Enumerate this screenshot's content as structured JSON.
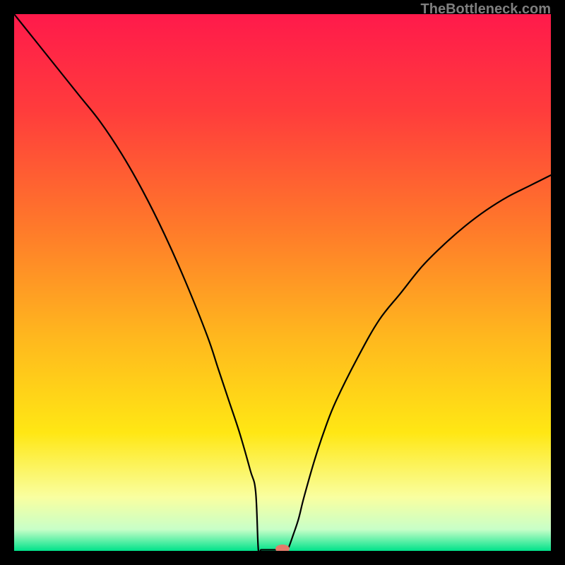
{
  "watermark": "TheBottleneck.com",
  "gradient": {
    "stops": [
      {
        "id": "g0",
        "offset": "0%",
        "color": "#ff1a4b"
      },
      {
        "id": "g1",
        "offset": "18%",
        "color": "#ff3c3c"
      },
      {
        "id": "g2",
        "offset": "40%",
        "color": "#ff7a2a"
      },
      {
        "id": "g3",
        "offset": "60%",
        "color": "#ffb71e"
      },
      {
        "id": "g4",
        "offset": "78%",
        "color": "#ffe714"
      },
      {
        "id": "g5",
        "offset": "90%",
        "color": "#f9ffa0"
      },
      {
        "id": "g6",
        "offset": "96%",
        "color": "#c8ffc8"
      },
      {
        "id": "g7",
        "offset": "100%",
        "color": "#00e28a"
      }
    ]
  },
  "chart_data": {
    "type": "line",
    "title": "",
    "xlabel": "",
    "ylabel": "",
    "xlim": [
      0,
      100
    ],
    "ylim": [
      0,
      100
    ],
    "marker": {
      "x": 50,
      "y": 0
    },
    "x": [
      0,
      4,
      8,
      12,
      16,
      20,
      24,
      28,
      32,
      36,
      38,
      40,
      42,
      44,
      45,
      46,
      47,
      48,
      50,
      51,
      52,
      53,
      54,
      56,
      58,
      60,
      64,
      68,
      72,
      76,
      80,
      84,
      88,
      92,
      96,
      100
    ],
    "values": [
      100,
      95,
      90,
      85,
      80,
      74,
      67,
      59,
      50,
      40,
      34,
      28,
      22,
      15,
      11,
      7,
      3,
      0.3,
      0,
      0.3,
      3,
      6,
      10,
      17,
      23,
      28,
      36,
      43,
      48,
      53,
      57,
      60.5,
      63.5,
      66,
      68,
      70
    ],
    "flat_segment": {
      "from_x": 45.5,
      "to_x": 50.5,
      "y": 0.2
    }
  }
}
